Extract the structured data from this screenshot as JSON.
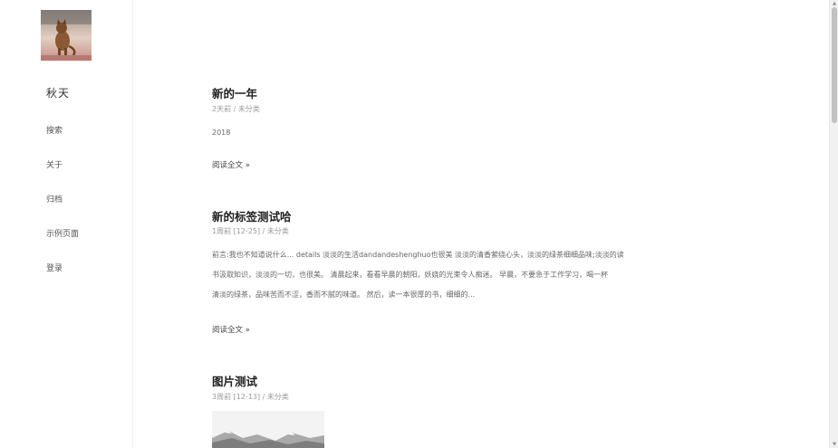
{
  "sidebar": {
    "site_title": "秋天",
    "nav": [
      {
        "label": "搜索"
      },
      {
        "label": "关于"
      },
      {
        "label": "归档"
      },
      {
        "label": "示例页面"
      },
      {
        "label": "登录"
      }
    ]
  },
  "posts": [
    {
      "title": "新的一年",
      "meta": "2天前 / 未分类",
      "body": "2018",
      "read_more": "阅读全文 »"
    },
    {
      "title": "新的标签测试哈",
      "meta": "1周前 [12-25] / 未分类",
      "body_lines": [
        "前言:我也不知道说什么... details 淡淡的生活dandandeshenghuo也很美 淡淡的清香萦绕心头，淡淡的绿茶细细品味;淡淡的读",
        "书汲取知识，淡淡的一切，也很美。 清晨起来，看看早晨的朝阳，妖娆的光束令人痴迷。 早晨，不要急于工作学习，喝一杯",
        "清淡的绿茶，品味苦而不涩，香而不腻的味道。 然后，读一本很厚的书，细细的..."
      ],
      "read_more": "阅读全文 »"
    },
    {
      "title": "图片测试",
      "meta": "3周前 [12-13] / 未分类"
    }
  ],
  "colors": {
    "title": "#222222",
    "meta": "#999999",
    "body": "#666666",
    "divider": "#f0f0f0"
  }
}
